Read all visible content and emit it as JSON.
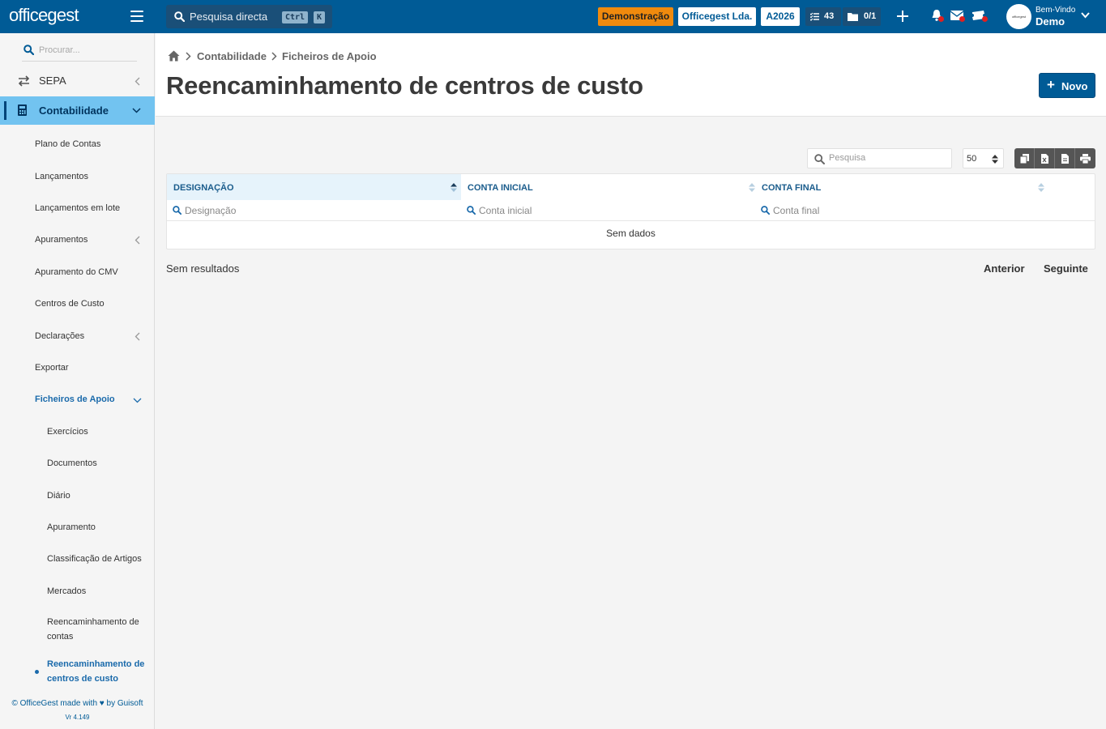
{
  "topbar": {
    "logo": "officegest",
    "search_placeholder": "Pesquisa directa",
    "kbd_ctrl": "Ctrl",
    "kbd_k": "K",
    "demo_badge": "Demonstração",
    "company": "Officegest Lda.",
    "year": "A2026",
    "tasks_count": "43",
    "docs_count": "0/1",
    "avatar_text": "officegest",
    "welcome": "Bem-Vindo",
    "user": "Demo",
    "accent_color": "#005b96",
    "demo_color": "#f08a0d"
  },
  "sidebar": {
    "search_placeholder": "Procurar...",
    "sepa": "SEPA",
    "section": "Contabilidade",
    "items": [
      {
        "label": "Plano de Contas"
      },
      {
        "label": "Lançamentos"
      },
      {
        "label": "Lançamentos em lote"
      },
      {
        "label": "Apuramentos"
      },
      {
        "label": "Apuramento do CMV"
      },
      {
        "label": "Centros de Custo"
      },
      {
        "label": "Declarações"
      },
      {
        "label": "Exportar"
      },
      {
        "label": "Ficheiros de Apoio"
      }
    ],
    "subitems": [
      {
        "label": "Exercícios"
      },
      {
        "label": "Documentos"
      },
      {
        "label": "Diário"
      },
      {
        "label": "Apuramento"
      },
      {
        "label": "Classificação de Artigos"
      },
      {
        "label": "Mercados"
      },
      {
        "label": "Reencaminhamento de contas"
      },
      {
        "label": "Reencaminhamento de centros de custo"
      }
    ],
    "footer": "© OfficeGest made with ♥ by Guisoft",
    "version": "Vr 4.149"
  },
  "breadcrumb": [
    "Contabilidade",
    "Ficheiros de Apoio"
  ],
  "page": {
    "title": "Reencaminhamento de centros de custo",
    "new_button": "Novo"
  },
  "table": {
    "search_placeholder": "Pesquisa",
    "page_size": "50",
    "columns": [
      "DESIGNAÇÃO",
      "CONTA INICIAL",
      "CONTA FINAL"
    ],
    "filters": [
      "Designação",
      "Conta inicial",
      "Conta final"
    ],
    "no_data": "Sem dados",
    "results_text": "Sem resultados",
    "prev": "Anterior",
    "next": "Seguinte"
  }
}
